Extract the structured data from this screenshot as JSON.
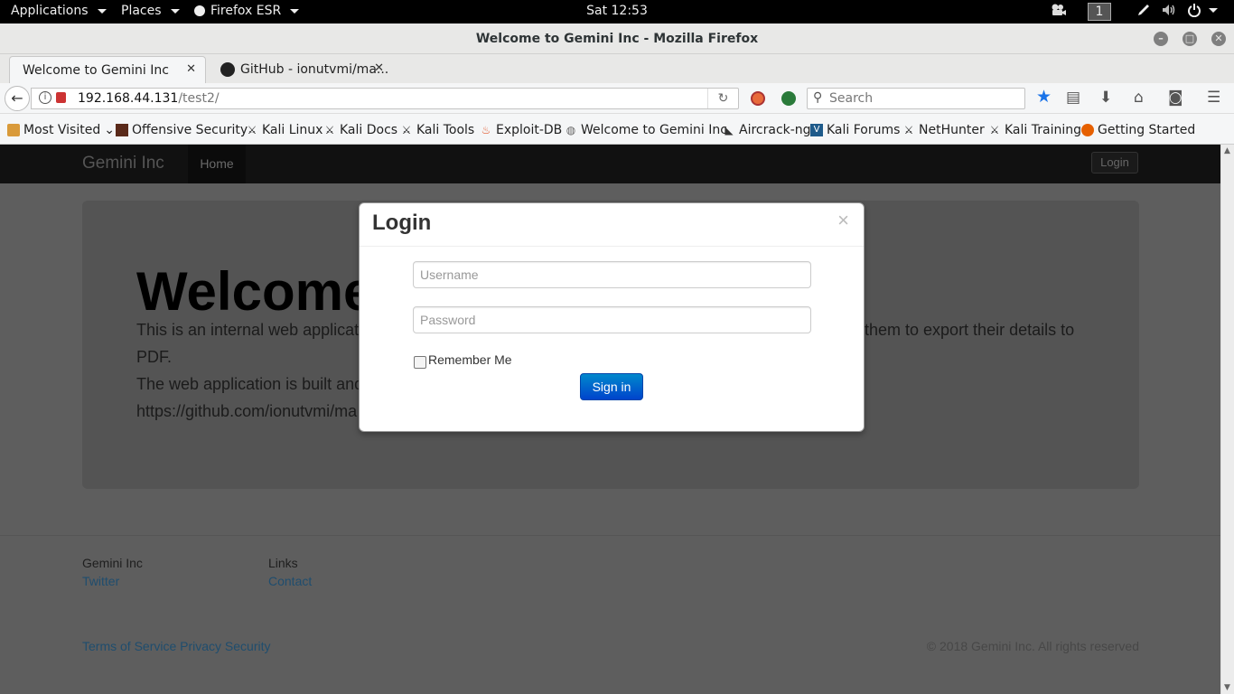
{
  "topbar": {
    "applications": "Applications",
    "places": "Places",
    "firefox_menu": "Firefox ESR",
    "clock": "Sat 12:53",
    "workspace": "1"
  },
  "window": {
    "title": "Welcome to Gemini Inc - Mozilla Firefox"
  },
  "tabs": [
    {
      "label": "Welcome to Gemini Inc"
    },
    {
      "label": "GitHub - ionutvmi/ma..."
    }
  ],
  "navbar": {
    "url_host": "192.168.44.131",
    "url_path": "/test2/",
    "search_placeholder": "Search"
  },
  "bookmarks": [
    {
      "label": "Most Visited",
      "icon": "folder-icon"
    },
    {
      "label": "Offensive Security",
      "icon": "offsec-icon"
    },
    {
      "label": "Kali Linux",
      "icon": "kali-icon"
    },
    {
      "label": "Kali Docs",
      "icon": "kali-icon"
    },
    {
      "label": "Kali Tools",
      "icon": "kali-icon"
    },
    {
      "label": "Exploit-DB",
      "icon": "exploitdb-icon"
    },
    {
      "label": "Welcome to Gemini Inc",
      "icon": "globe-icon"
    },
    {
      "label": "Aircrack-ng",
      "icon": "aircrack-icon"
    },
    {
      "label": "Kali Forums",
      "icon": "forums-icon"
    },
    {
      "label": "NetHunter",
      "icon": "kali-icon"
    },
    {
      "label": "Kali Training",
      "icon": "kali-icon"
    },
    {
      "label": "Getting Started",
      "icon": "firefox-icon"
    }
  ],
  "site": {
    "brand": "Gemini Inc",
    "nav_home": "Home",
    "login_button": "Login",
    "hero_title": "Welcome",
    "hero_line1_left": "This is an internal web applicat",
    "hero_line1_right": "them to export their details to",
    "hero_line2": "PDF.",
    "hero_line3": "The web application is built and",
    "hero_line4": "https://github.com/ionutvmi/ma"
  },
  "footer": {
    "col1_heading": "Gemini Inc",
    "col1_link": "Twitter",
    "col2_heading": "Links",
    "col2_link": "Contact",
    "bottom_links": "Terms of Service Privacy Security",
    "copyright": "© 2018 Gemini Inc. All rights reserved"
  },
  "modal": {
    "title": "Login",
    "close": "×",
    "username_placeholder": "Username",
    "password_placeholder": "Password",
    "remember_label": "Remember Me",
    "signin_label": "Sign in"
  },
  "colors": {
    "accent_blue": "#0066cc",
    "overlay": "#5e5e5e",
    "site_nav": "#111111"
  }
}
